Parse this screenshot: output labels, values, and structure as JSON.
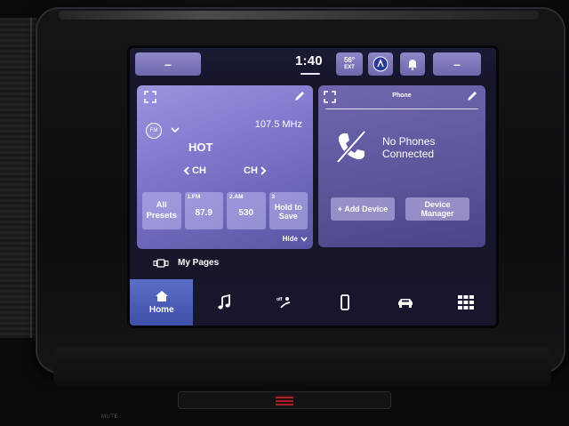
{
  "statusbar": {
    "left_button_label": "–",
    "clock": "1:40",
    "temperature": "56°",
    "temperature_label": "EXT",
    "right_button_label": "–"
  },
  "radio": {
    "band_badge": "FM",
    "frequency": "107.5 MHz",
    "station_name": "HOT",
    "channel_prev_label": "CH",
    "channel_next_label": "CH",
    "presets": [
      {
        "number": "",
        "label": "All Presets"
      },
      {
        "number": "1.FM",
        "label": "87.9"
      },
      {
        "number": "2.AM",
        "label": "530"
      },
      {
        "number": "3",
        "label": "Hold to Save"
      }
    ],
    "hide_label": "Hide"
  },
  "phone": {
    "title": "Phone",
    "status_line1": "No Phones",
    "status_line2": "Connected",
    "add_device_label": "+ Add Device",
    "device_manager_line1": "Device",
    "device_manager_line2": "Manager"
  },
  "mypages": {
    "label": "My Pages"
  },
  "nav": {
    "items": [
      {
        "icon": "home-icon",
        "label": "Home"
      },
      {
        "icon": "music-icon",
        "label": ""
      },
      {
        "icon": "climate-icon",
        "label": ""
      },
      {
        "icon": "phone-icon",
        "label": ""
      },
      {
        "icon": "vehicle-icon",
        "label": ""
      },
      {
        "icon": "apps-icon",
        "label": ""
      }
    ]
  },
  "hardware": {
    "mute_label": "MUTE"
  },
  "colors": {
    "card_radio": "#8078cc",
    "card_phone": "#5a5499",
    "accent_button": "#8e88c8",
    "nav_active": "#4a5cb8",
    "screen_bg": "#15162a"
  }
}
